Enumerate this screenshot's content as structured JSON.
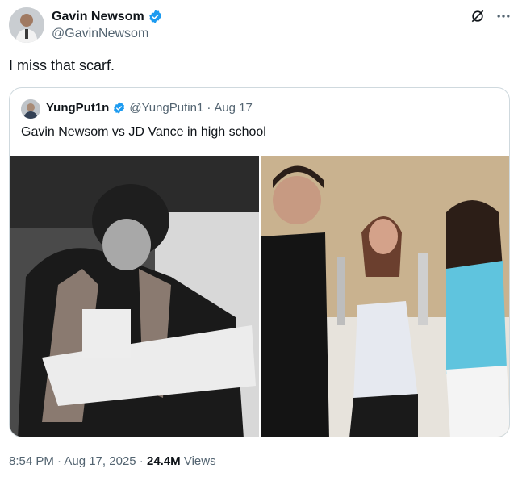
{
  "author": {
    "name": "Gavin Newsom",
    "handle": "@GavinNewsom",
    "verified_icon": "verified-badge-icon"
  },
  "post": {
    "text": "I miss that scarf.",
    "time": "8:54 PM",
    "separator1": " · ",
    "date": "Aug 17, 2025",
    "separator2": " · ",
    "views_count": "24.4M",
    "views_label": " Views"
  },
  "quoted": {
    "name": "YungPut1n",
    "handle": "@YungPutin1",
    "separator": " · ",
    "date": "Aug 17",
    "text": "Gavin Newsom vs JD Vance in high school"
  },
  "icons": [
    "grok-icon",
    "more-icon",
    "verified-badge-icon"
  ],
  "colors": {
    "accent": "#1d9bf0",
    "text": "#0f1419",
    "muted": "#536471",
    "border": "#cfd9de"
  }
}
